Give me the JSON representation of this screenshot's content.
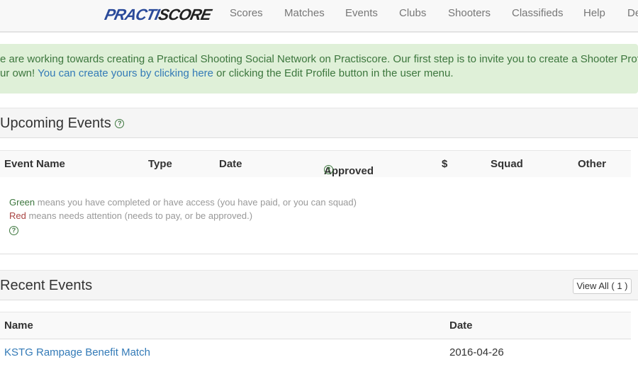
{
  "nav": {
    "logo_a": "PRACTI",
    "logo_b": "SCORE",
    "items": [
      "Scores",
      "Matches",
      "Events",
      "Clubs",
      "Shooters",
      "Classifieds",
      "Help",
      "De"
    ]
  },
  "alert": {
    "line1": "e are working towards creating a Practical Shooting Social Network on Practiscore. Our first step is to invite you to create a Shooter Profile o",
    "line2_a": "ur own! ",
    "line2_link": "You can create yours by clicking here",
    "line2_b": " or clicking the Edit Profile button in the user menu."
  },
  "upcoming": {
    "title": "Upcoming Events",
    "columns": [
      "Event Name",
      "Type",
      "Date",
      "Approved",
      "$",
      "Squad",
      "Other"
    ],
    "legend": {
      "green_word": "Green",
      "green_text": " means you have completed or have access (you have paid, or you can squad)",
      "red_word": "Red",
      "red_text": " means needs attention (needs to pay, or be approved.)"
    },
    "help_glyph": "?"
  },
  "recent": {
    "title": "Recent Events",
    "view_all": "View All ( 1 )",
    "columns": [
      "Name",
      "Date"
    ],
    "rows": [
      {
        "name": "KSTG Rampage Benefit Match",
        "date": "2016-04-26"
      }
    ]
  },
  "colors": {
    "alert_bg": "#dff0d8",
    "alert_text": "#3c763d",
    "link": "#337ab7",
    "green": "#3c763d",
    "red": "#a94442"
  }
}
